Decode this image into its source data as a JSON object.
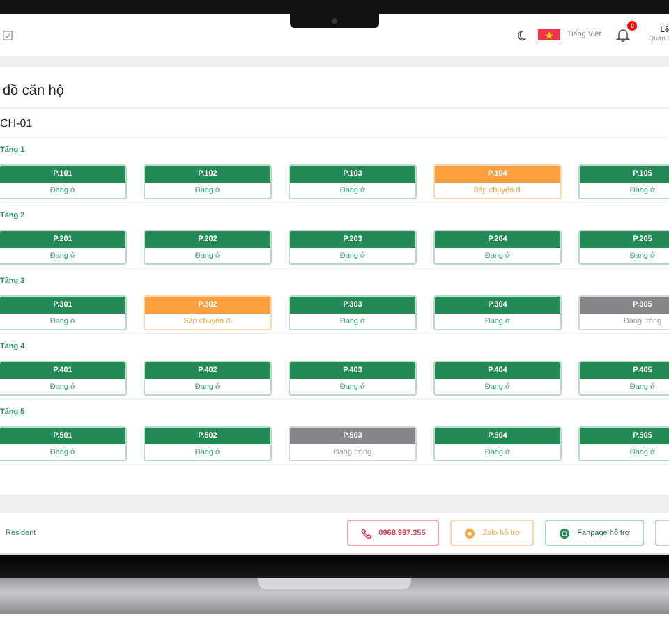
{
  "header": {
    "language": "Tiếng Việt",
    "notification_count": "0",
    "user_name": "Lê",
    "user_role": "Quản l"
  },
  "page_title": "đồ căn hộ",
  "building": "CH-01",
  "floors": [
    {
      "label": "Tầng 1",
      "rooms": [
        {
          "name": "P.101",
          "kind": "occupied",
          "status": "Đang ở"
        },
        {
          "name": "P.102",
          "kind": "occupied",
          "status": "Đang ở"
        },
        {
          "name": "P.103",
          "kind": "occupied",
          "status": "Đang ở"
        },
        {
          "name": "P.104",
          "kind": "moving",
          "status": "Sắp chuyển đi"
        },
        {
          "name": "P.105",
          "kind": "occupied",
          "status": "Đang ở"
        }
      ]
    },
    {
      "label": "Tầng 2",
      "rooms": [
        {
          "name": "P.201",
          "kind": "occupied",
          "status": "Đang ở"
        },
        {
          "name": "P.202",
          "kind": "occupied",
          "status": "Đang ở"
        },
        {
          "name": "P.203",
          "kind": "occupied",
          "status": "Đang ở"
        },
        {
          "name": "P.204",
          "kind": "occupied",
          "status": "Đang ở"
        },
        {
          "name": "P.205",
          "kind": "occupied",
          "status": "Đang ở"
        }
      ]
    },
    {
      "label": "Tầng 3",
      "rooms": [
        {
          "name": "P.301",
          "kind": "occupied",
          "status": "Đang ở"
        },
        {
          "name": "P.302",
          "kind": "moving",
          "status": "Sắp chuyển đi"
        },
        {
          "name": "P.303",
          "kind": "occupied",
          "status": "Đang ở"
        },
        {
          "name": "P.304",
          "kind": "occupied",
          "status": "Đang ở"
        },
        {
          "name": "P.305",
          "kind": "vacant",
          "status": "Đang trống"
        }
      ]
    },
    {
      "label": "Tầng 4",
      "rooms": [
        {
          "name": "P.401",
          "kind": "occupied",
          "status": "Đang ở"
        },
        {
          "name": "P.402",
          "kind": "occupied",
          "status": "Đang ở"
        },
        {
          "name": "P.403",
          "kind": "occupied",
          "status": "Đang ở"
        },
        {
          "name": "P.404",
          "kind": "occupied",
          "status": "Đang ở"
        },
        {
          "name": "P.405",
          "kind": "occupied",
          "status": "Đang ở"
        }
      ]
    },
    {
      "label": "Tầng 5",
      "rooms": [
        {
          "name": "P.501",
          "kind": "occupied",
          "status": "Đang ở"
        },
        {
          "name": "P.502",
          "kind": "occupied",
          "status": "Đang ở"
        },
        {
          "name": "P.503",
          "kind": "vacant",
          "status": "Đang trống"
        },
        {
          "name": "P.504",
          "kind": "occupied",
          "status": "Đang ở"
        },
        {
          "name": "P.505",
          "kind": "occupied",
          "status": "Đang ở"
        }
      ]
    }
  ],
  "footer": {
    "brand": "Resident",
    "buttons": [
      {
        "kind": "phone",
        "label": "0968.987.355"
      },
      {
        "kind": "zalo",
        "label": "Zalo hỗ trợ"
      },
      {
        "kind": "fanpage",
        "label": "Fanpage hỗ trợ"
      },
      {
        "kind": "other"
      }
    ]
  }
}
